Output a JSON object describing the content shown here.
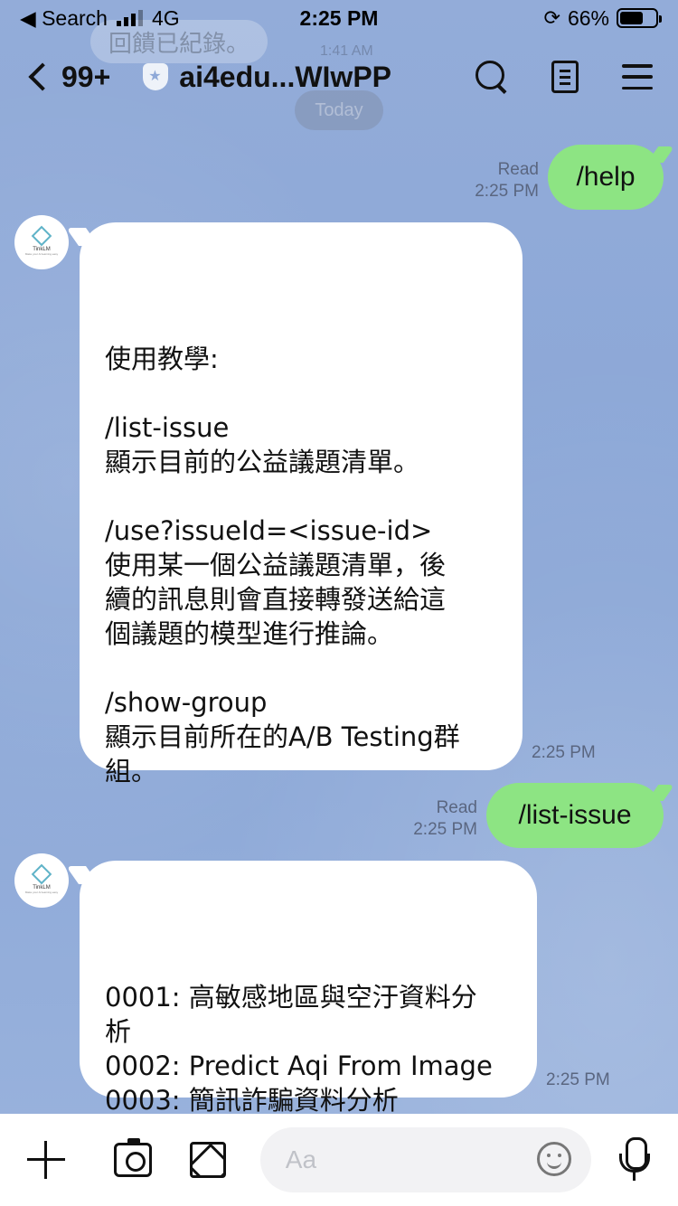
{
  "status_bar": {
    "carrier_back": "◀ Search",
    "network": "4G",
    "time": "2:25 PM",
    "battery": "66%",
    "battery_level": 0.66
  },
  "header": {
    "back_count": "99+",
    "title": "ai4edu...WIwPP",
    "icons": [
      "search-icon",
      "note-icon",
      "menu-icon"
    ]
  },
  "background": {
    "ghost_message": "回饋已紀錄。",
    "ghost_time": "1:41 AM",
    "date_divider": "Today"
  },
  "messages": [
    {
      "direction": "out",
      "text": "/help",
      "read": "Read",
      "time": "2:25 PM"
    },
    {
      "direction": "in",
      "text": "使用教學:\n\n/list-issue\n顯示目前的公益議題清單。\n\n/use?issueId=<issue-id>\n使用某一個公益議題清單，後\n續的訊息則會直接轉發送給這\n個議題的模型進行推論。\n\n/show-group\n顯示目前所在的A/B Testing群\n組。",
      "time": "2:25 PM"
    },
    {
      "direction": "out",
      "text": "/list-issue",
      "read": "Read",
      "time": "2:25 PM"
    },
    {
      "direction": "in",
      "text": "0001: 高敏感地區與空汙資料分\n析\n0002: Predict Aqi From Image\n0003: 簡訊詐騙資料分析",
      "time": "2:25 PM"
    }
  ],
  "bot_avatar": {
    "name": "TinkLM",
    "tagline": "Make your AI learning easy"
  },
  "composer": {
    "placeholder": "Aa",
    "value": ""
  },
  "colors": {
    "outgoing_bubble": "#8de483",
    "incoming_bubble": "#ffffff",
    "chat_background": "#8fa9d8"
  }
}
